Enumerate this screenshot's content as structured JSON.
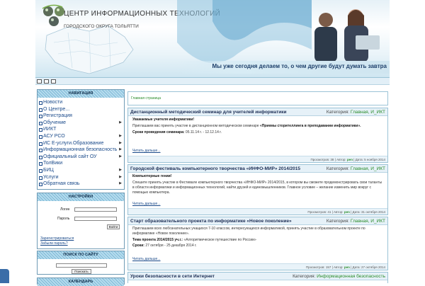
{
  "header": {
    "title": "ЦЕНТР ИНФОРМАЦИОННЫХ ТЕХНОЛОГИЙ",
    "subtitle": "ГОРОДСКОГО ОКРУГА ТОЛЬЯТТИ",
    "slogan": "Мы уже сегодня делаем то, о чем другие будут думать завтра"
  },
  "toolbar": {
    "icons": [
      "home-icon",
      "print-icon",
      "doc-icon"
    ]
  },
  "nav": {
    "title": "НАВИГАЦИЯ",
    "items": [
      {
        "label": "Новости",
        "submenu": false
      },
      {
        "label": "О Центре...",
        "submenu": false
      },
      {
        "label": "Регистрация",
        "submenu": false
      },
      {
        "label": "Обучение",
        "submenu": true
      },
      {
        "label": "ИИКТ",
        "submenu": false
      },
      {
        "label": "АСУ РСО",
        "submenu": true
      },
      {
        "label": "ИС Е-услуги.Образование",
        "submenu": true
      },
      {
        "label": "Информационная безопасность",
        "submenu": true
      },
      {
        "label": "Официальный сайт ОУ",
        "submenu": true
      },
      {
        "label": "ТолВики",
        "submenu": false
      },
      {
        "label": "БИЦ",
        "submenu": true
      },
      {
        "label": "Услуги",
        "submenu": true
      },
      {
        "label": "Обратная связь",
        "submenu": true
      }
    ]
  },
  "settings": {
    "title": "НАСТРОЙКИ",
    "login_label": "Логин",
    "password_label": "Пароль",
    "login_button": "Войти",
    "register_link": "Зарегистрироваться",
    "forgot_link": "Забыли пароль?"
  },
  "search": {
    "title": "ПОИСК ПО САЙТУ",
    "button": "Поискать"
  },
  "calendar": {
    "title": "КАЛЕНДАРЬ"
  },
  "breadcrumb": "Главная страница",
  "articles": [
    {
      "title": "Дистанционный методический семинар для учителей информатики",
      "category_prefix": "Категория:",
      "category": "Главная, И_ИКТ",
      "greeting": "Уважаемые учителя информатики!",
      "text": "Приглашаем вас принять участие в дистанционном методическом семинаре",
      "highlight": "«Приемы сторителлинга в преподавании информатики».",
      "dates_label": "Сроки проведения семинара:",
      "dates": "05.11.14 г. - 12.12.14 г.",
      "read_more": "Читать дальше...",
      "views": "Просмотров: 38",
      "author_label": "Автор:",
      "author": "pen",
      "date": "Дата: 5 ноября 2014"
    },
    {
      "title": "Городской фестиваль компьютерного творчества «ИНФО-МИР» 2014/2015",
      "category_prefix": "Категория:",
      "category": "Главная, И_ИКТ",
      "greeting": "Компьютерные гении!",
      "text": "Спешите принять участие в Фестивале компьютерного творчества «ИНФО-МИР» 2014/2015, в котором вы сможете продемонстрировать свои таланты в области информатики и информационных технологий, найти друзей и единомышленников. Главное условие – желание изменить мир вокруг с помощью компьютера.",
      "read_more": "Читать дальше...",
      "views": "Просмотров: 41",
      "author_label": "Автор:",
      "author": "pen",
      "date": "Дата: 31 октября 2014"
    },
    {
      "title": "Старт образовательного проекта по информатике «Новое поколение»",
      "category_prefix": "Категория:",
      "category": "Главная, И_ИКТ",
      "text": "Приглашаем всех любознательных учащихся 7-10 классов, интересующихся информатикой, принять участие в образовательном проекте по информатике «Новое поколение».",
      "theme_label": "Тема проекта 2014/2015 уч.г.:",
      "theme": "«Алгоритмическое путешествие по России»",
      "dates_label": "Сроки:",
      "dates": "27 октября - 25 декабря 2014 г.",
      "read_more": "Читать дальше...",
      "views": "Просмотров: 157",
      "author_label": "Автор:",
      "author": "pen",
      "date": "Дата: 27 октября 2014"
    },
    {
      "title": "Уроки безопасности в сети Интернет",
      "category_prefix": "Категория:",
      "category": "Информационная безопасность"
    }
  ],
  "colors": {
    "accent": "#1a4a8a",
    "header_bar": "#7fb9d6",
    "link_green": "#2a8c2a",
    "border": "#9bc3d6"
  }
}
